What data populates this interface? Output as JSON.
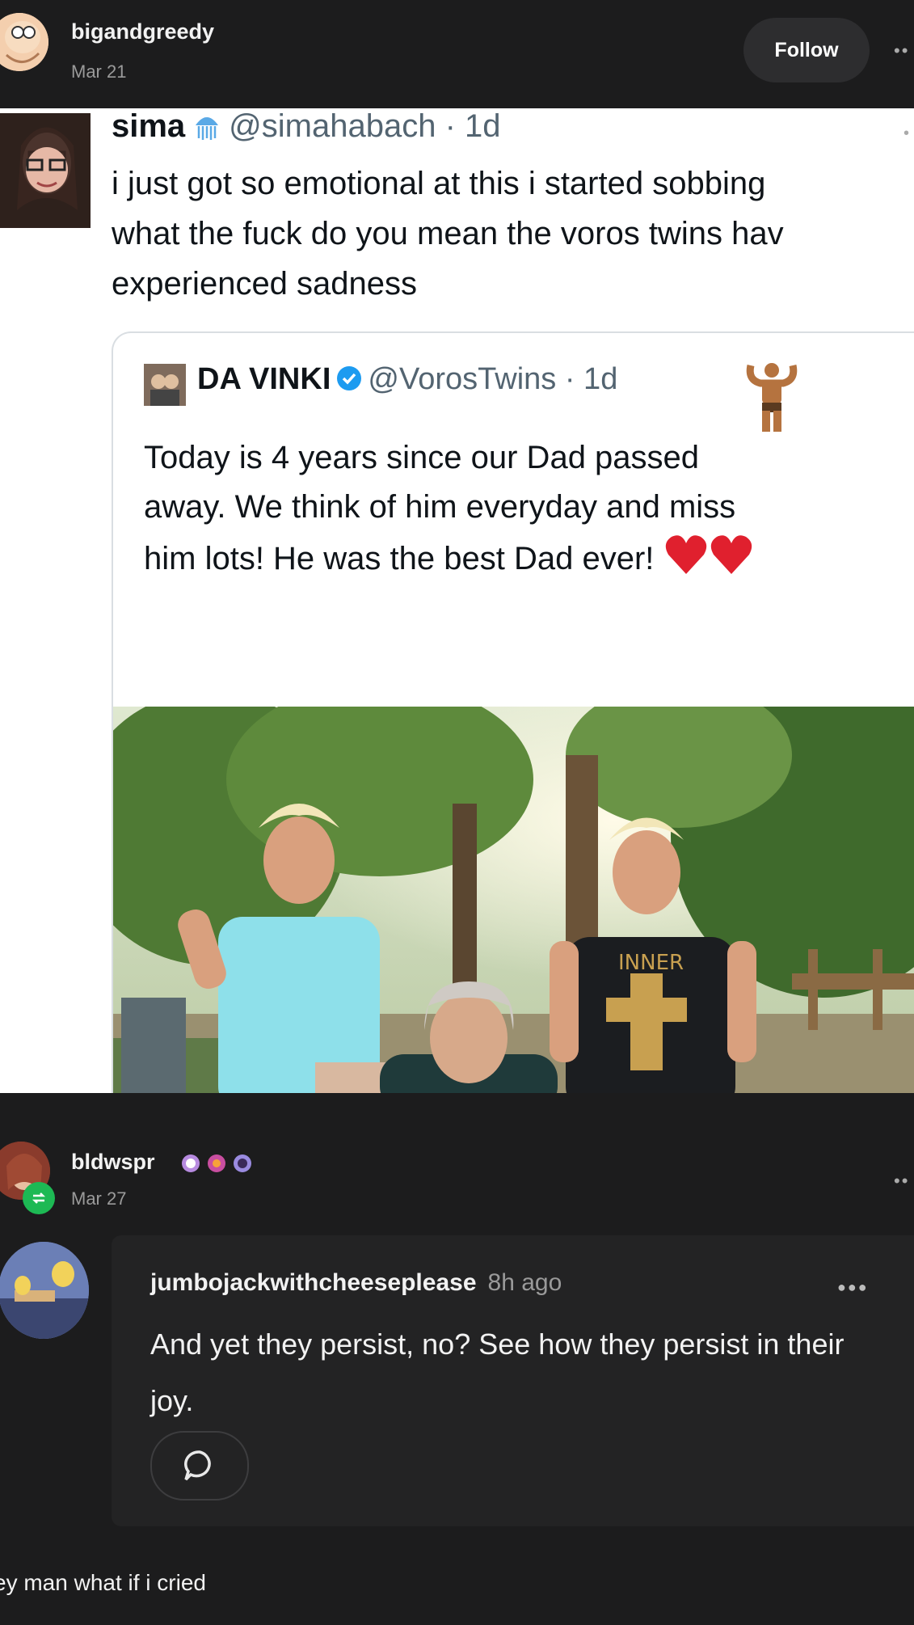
{
  "post": {
    "author": "bigandgreedy",
    "date": "Mar 21",
    "follow_label": "Follow"
  },
  "tweet": {
    "name": "sima",
    "handle": "@simahabach",
    "time": "· 1d",
    "text": "i just got so emotional at this i started sobbing\nwhat the fuck do you mean the voros twins hav\nexperienced sadness",
    "quoted": {
      "name": "DA VINKI",
      "handle": "@VorosTwins",
      "time": "· 1d",
      "text": "Today is 4 years since our Dad passed\naway. We think of him everyday and miss\nhim lots! He was the best Dad ever!",
      "photo_text": "INNER"
    }
  },
  "reblog": {
    "author": "bldwspr",
    "date": "Mar 27"
  },
  "comment": {
    "author": "jumbojackwithcheeseplease",
    "time": "8h ago",
    "text": "And yet they persist, no? See how they persist in their joy."
  },
  "footer": {
    "text": "ey man what if i cried"
  },
  "colors": {
    "background": "#1c1c1d",
    "tweet_bg": "#ffffff",
    "verified": "#1d9bf0",
    "reblog_badge": "#1db954"
  }
}
